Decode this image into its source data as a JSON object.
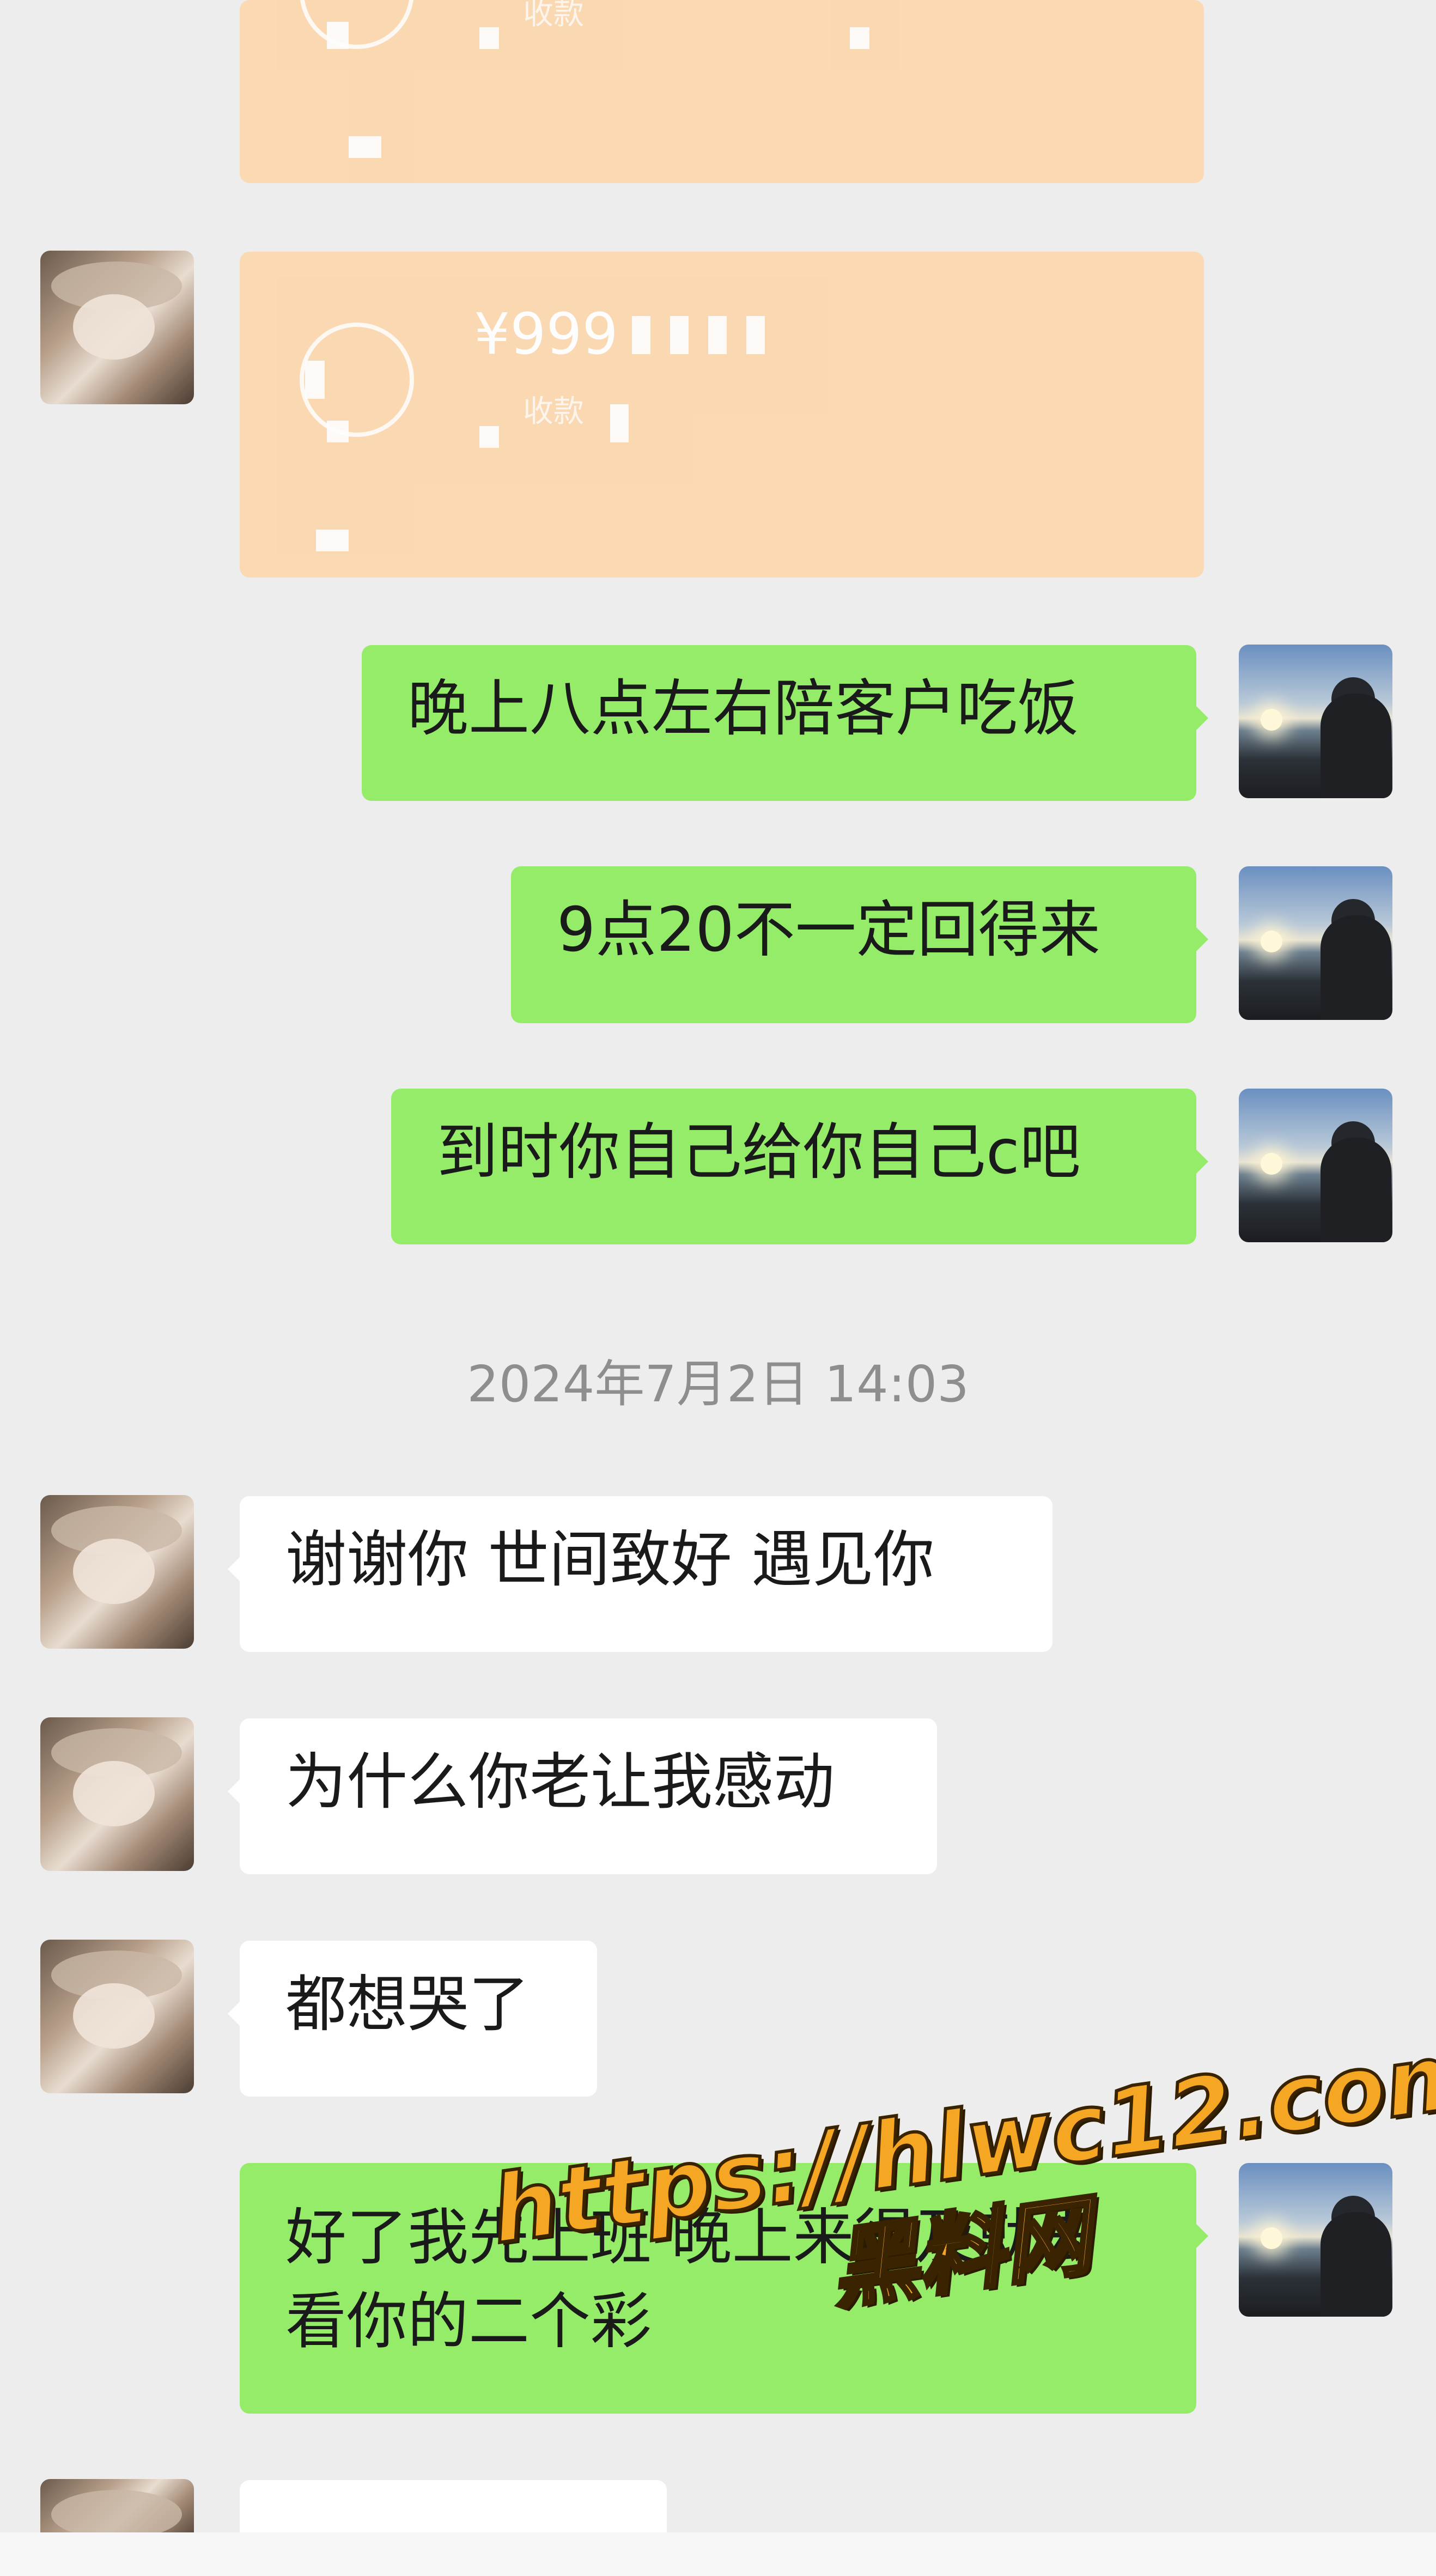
{
  "transfer_cards": [
    {
      "amount": "",
      "status": "收款"
    },
    {
      "amount": "¥999",
      "status": "收款"
    }
  ],
  "messages_before": [
    {
      "side": "right",
      "text": "晚上八点左右陪客户吃饭"
    },
    {
      "side": "right",
      "text": "9点20不一定回得来"
    },
    {
      "side": "right",
      "text": "到时你自己给你自己c吧"
    }
  ],
  "timestamp": "2024年7月2日 14:03",
  "messages_after": [
    {
      "side": "left",
      "text": "谢谢你 世间致好 遇见你"
    },
    {
      "side": "left",
      "text": "为什么你老让我感动"
    },
    {
      "side": "left",
      "text": "都想哭了"
    },
    {
      "side": "right",
      "text": "好了我先上班 晚上来得及就去看你的二个彩"
    }
  ],
  "watermark": {
    "url": "https://hlwc12.com",
    "site": "黑料网"
  },
  "colors": {
    "background": "#ededed",
    "sent_bubble": "#95ec69",
    "received_bubble": "#ffffff",
    "transfer_card": "#fbd7ae",
    "timestamp_text": "#8e8e8e"
  }
}
